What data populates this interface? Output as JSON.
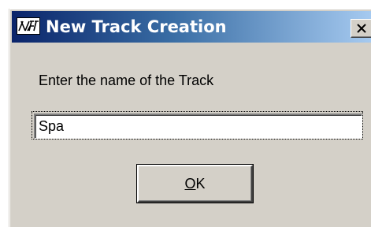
{
  "window": {
    "title": "New Track Creation",
    "icon": "app-logo-icon",
    "close_icon": "close-icon",
    "close_symbol": "✕"
  },
  "dialog": {
    "prompt": "Enter the name of the Track",
    "input_value": "Spa",
    "ok_label": "OK"
  },
  "colors": {
    "titlebar_start": "#0a246a",
    "titlebar_end": "#a6caf0",
    "face": "#d4d0c8"
  }
}
